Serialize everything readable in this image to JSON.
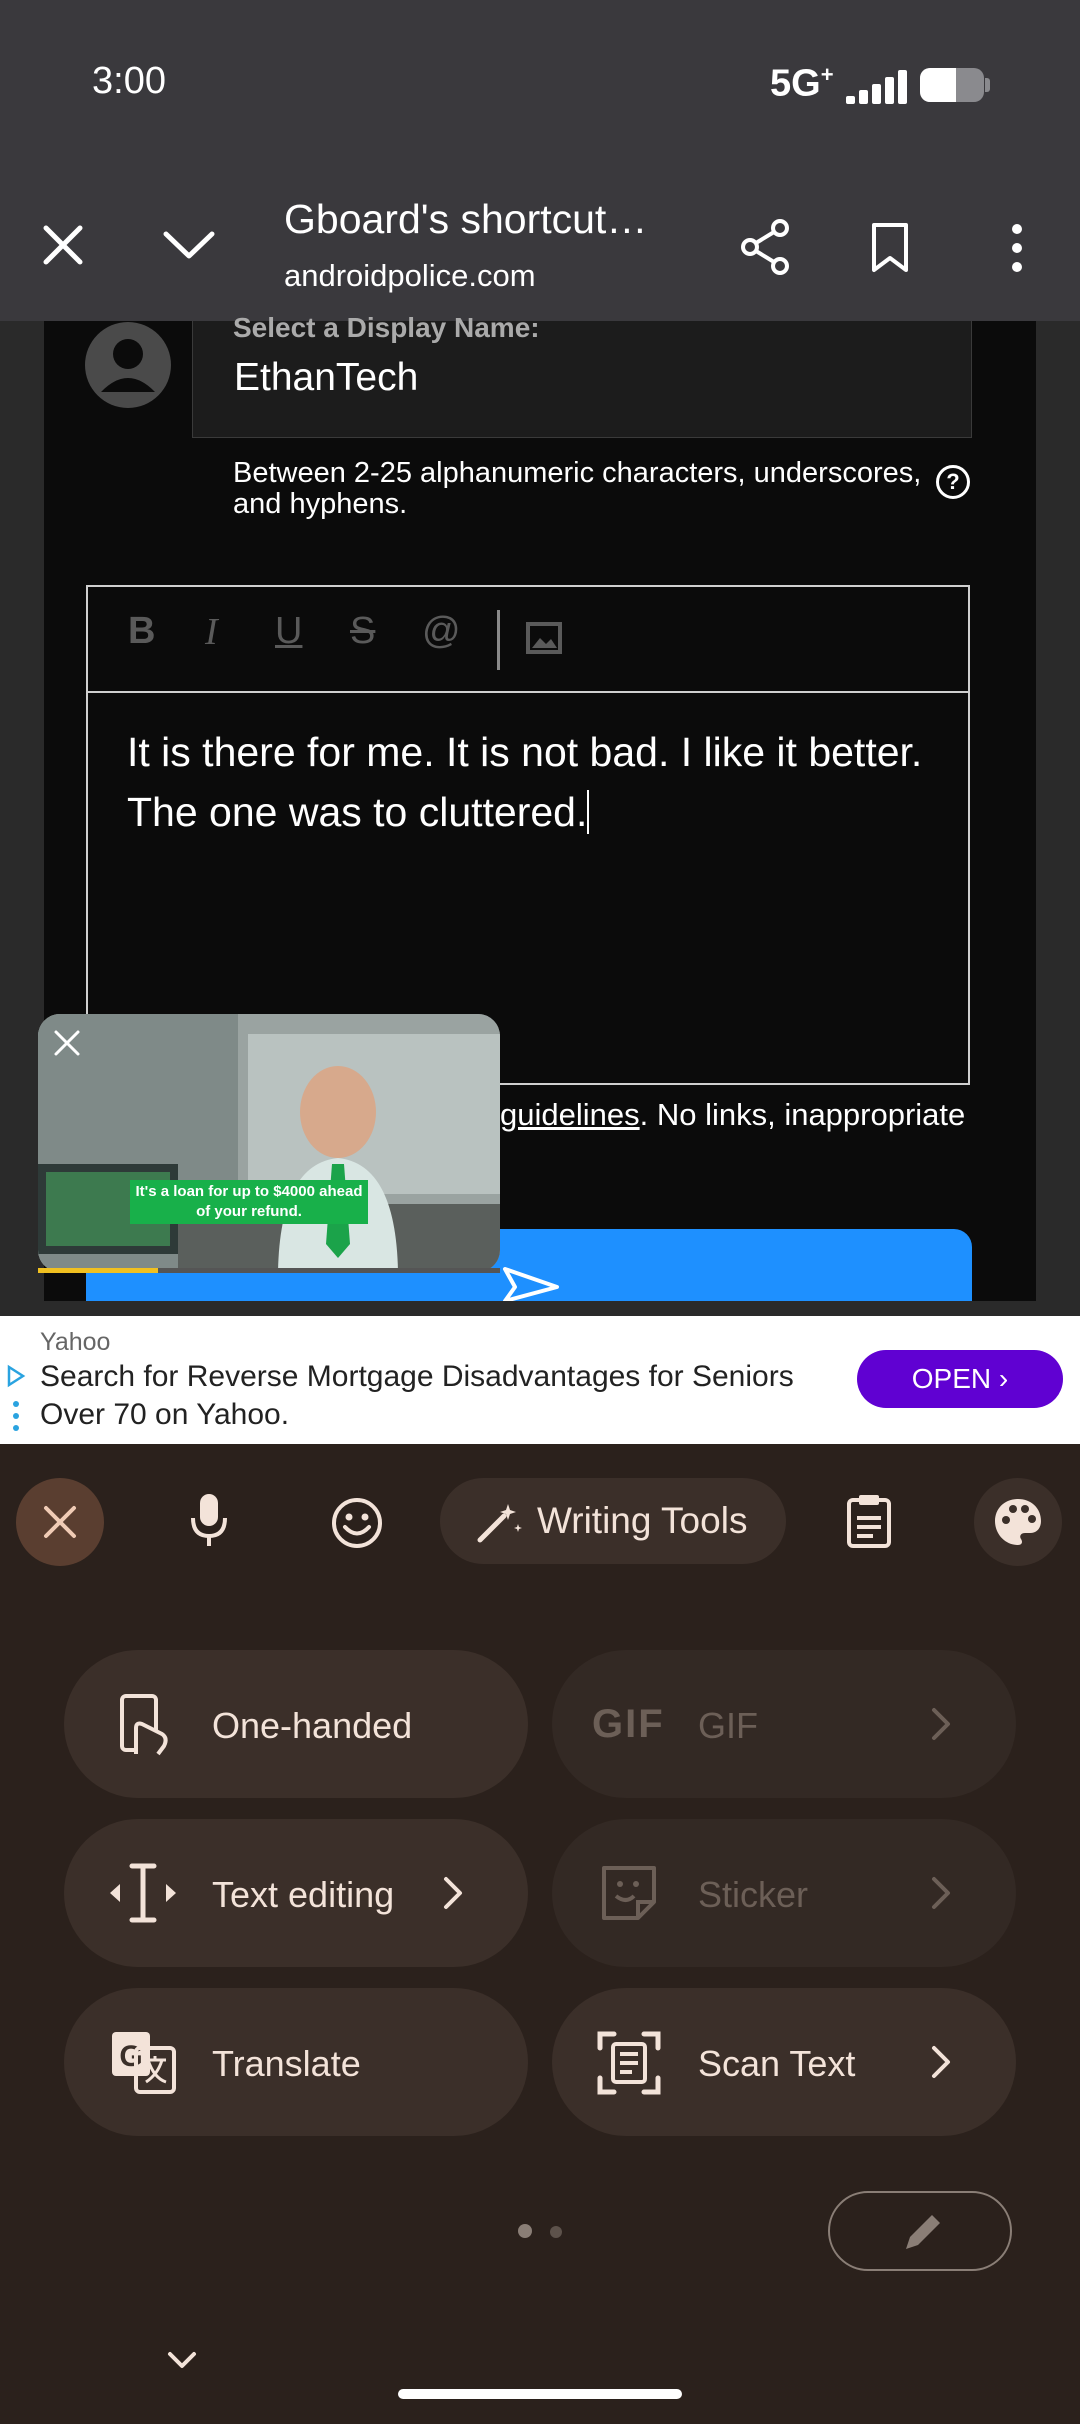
{
  "status_bar": {
    "time": "3:00",
    "network": "5G",
    "network_sup": "+"
  },
  "browser": {
    "title": "Gboard's shortcut…",
    "url": "androidpolice.com"
  },
  "comment_form": {
    "name_label": "Select a Display Name:",
    "name_value": "EthanTech",
    "name_hint": "Between 2-25 alphanumeric characters, underscores, and hyphens.",
    "help_glyph": "?",
    "toolbar": {
      "bold": "B",
      "italic": "I",
      "underline": "U",
      "strike": "S",
      "mention": "@"
    },
    "text": "It is there for me. It is not bad. I like it better. The one was to cluttered.",
    "guidelines_link": "guidelines",
    "guidelines_rest": ". No links, inappropriate"
  },
  "video_ad": {
    "caption": "It's a loan for up to $4000 ahead of your refund.",
    "progress": 0.26
  },
  "yahoo_ad": {
    "source": "Yahoo",
    "text": "Search for Reverse Mortgage Disadvantages for Seniors Over 70 on Yahoo.",
    "button": "OPEN"
  },
  "keyboard": {
    "writing_tools": "Writing Tools",
    "tiles": [
      {
        "label": "One-handed",
        "icon": "one-handed-icon",
        "enabled": true
      },
      {
        "label": "GIF",
        "icon": "gif-icon",
        "enabled": false
      },
      {
        "label": "Text editing",
        "icon": "text-cursor-icon",
        "enabled": true
      },
      {
        "label": "Sticker",
        "icon": "sticker-icon",
        "enabled": false
      },
      {
        "label": "Translate",
        "icon": "translate-icon",
        "enabled": true
      },
      {
        "label": "Scan Text",
        "icon": "scan-text-icon",
        "enabled": true
      }
    ],
    "gif_badge": "GIF"
  },
  "colors": {
    "accent_blue": "#1e90ff",
    "yahoo_purple": "#6001d2",
    "keyboard_bg": "#2b211c"
  }
}
